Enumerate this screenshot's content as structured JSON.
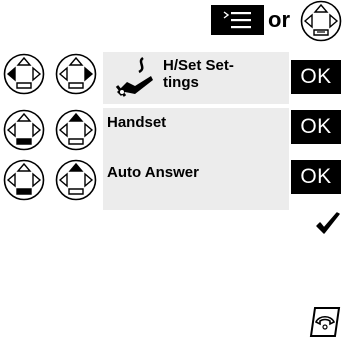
{
  "header": {
    "or_label": "or"
  },
  "steps": [
    {
      "label": "H/Set Set-\ntings",
      "ok_label": "OK"
    },
    {
      "label": "Handset",
      "ok_label": "OK"
    },
    {
      "label": "Auto Answer",
      "ok_label": "OK"
    }
  ],
  "icons": {
    "menu_key": "menu-key-icon",
    "control_key": "control-key-icon",
    "handset_settings": "handset-settings-icon",
    "checkmark": "checkmark-icon",
    "end_call": "end-call-key-icon"
  },
  "colors": {
    "panel_bg": "#ececec",
    "key_bg": "#000000",
    "key_text": "#ffffff"
  }
}
